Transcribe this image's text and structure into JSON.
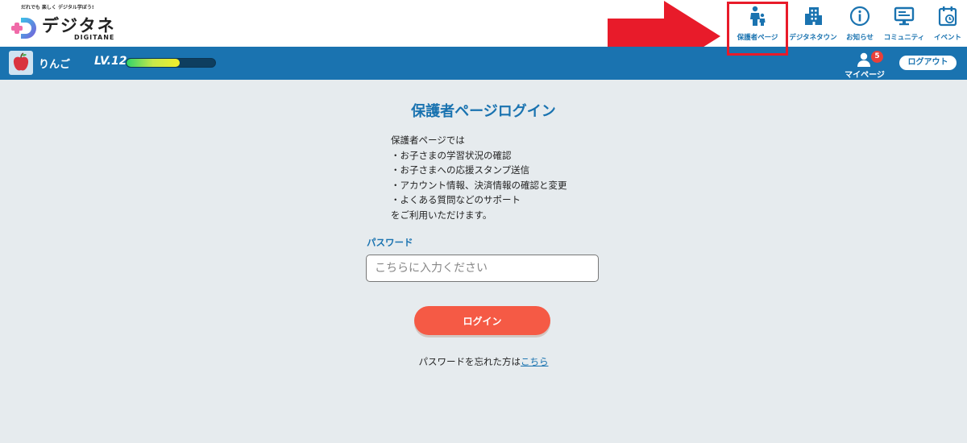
{
  "header": {
    "tagline": "だれでも 楽しく デジタル学ぼう!",
    "logo_name": "デジタネ",
    "logo_sub": "DIGITANE",
    "nav": [
      {
        "label": "保護者ページ",
        "icon": "parent-child-icon"
      },
      {
        "label": "デジタネタウン",
        "icon": "building-icon"
      },
      {
        "label": "お知らせ",
        "icon": "info-icon"
      },
      {
        "label": "コミュニティ",
        "icon": "monitor-icon"
      },
      {
        "label": "イベント",
        "icon": "calendar-icon"
      }
    ]
  },
  "user_bar": {
    "username": "りんご",
    "level": "LV.12",
    "xp_progress": 0.6,
    "mypage_label": "マイページ",
    "notification_count": "5",
    "logout_label": "ログアウト"
  },
  "main": {
    "title": "保護者ページログイン",
    "intro_lines": [
      "保護者ページでは",
      "・お子さまの学習状況の確認",
      "・お子さまへの応援スタンプ送信",
      "・アカウント情報、決済情報の確認と変更",
      "・よくある質問などのサポート",
      "をご利用いただけます。"
    ],
    "password_label": "パスワード",
    "password_placeholder": "こちらに入力ください",
    "login_label": "ログイン",
    "forgot_text": "パスワードを忘れた方は",
    "forgot_link": "こちら"
  },
  "colors": {
    "brand_blue": "#1a73b0",
    "login_button": "#f55a45",
    "annotation_red": "#e81b2a",
    "background": "#e6ebee"
  }
}
